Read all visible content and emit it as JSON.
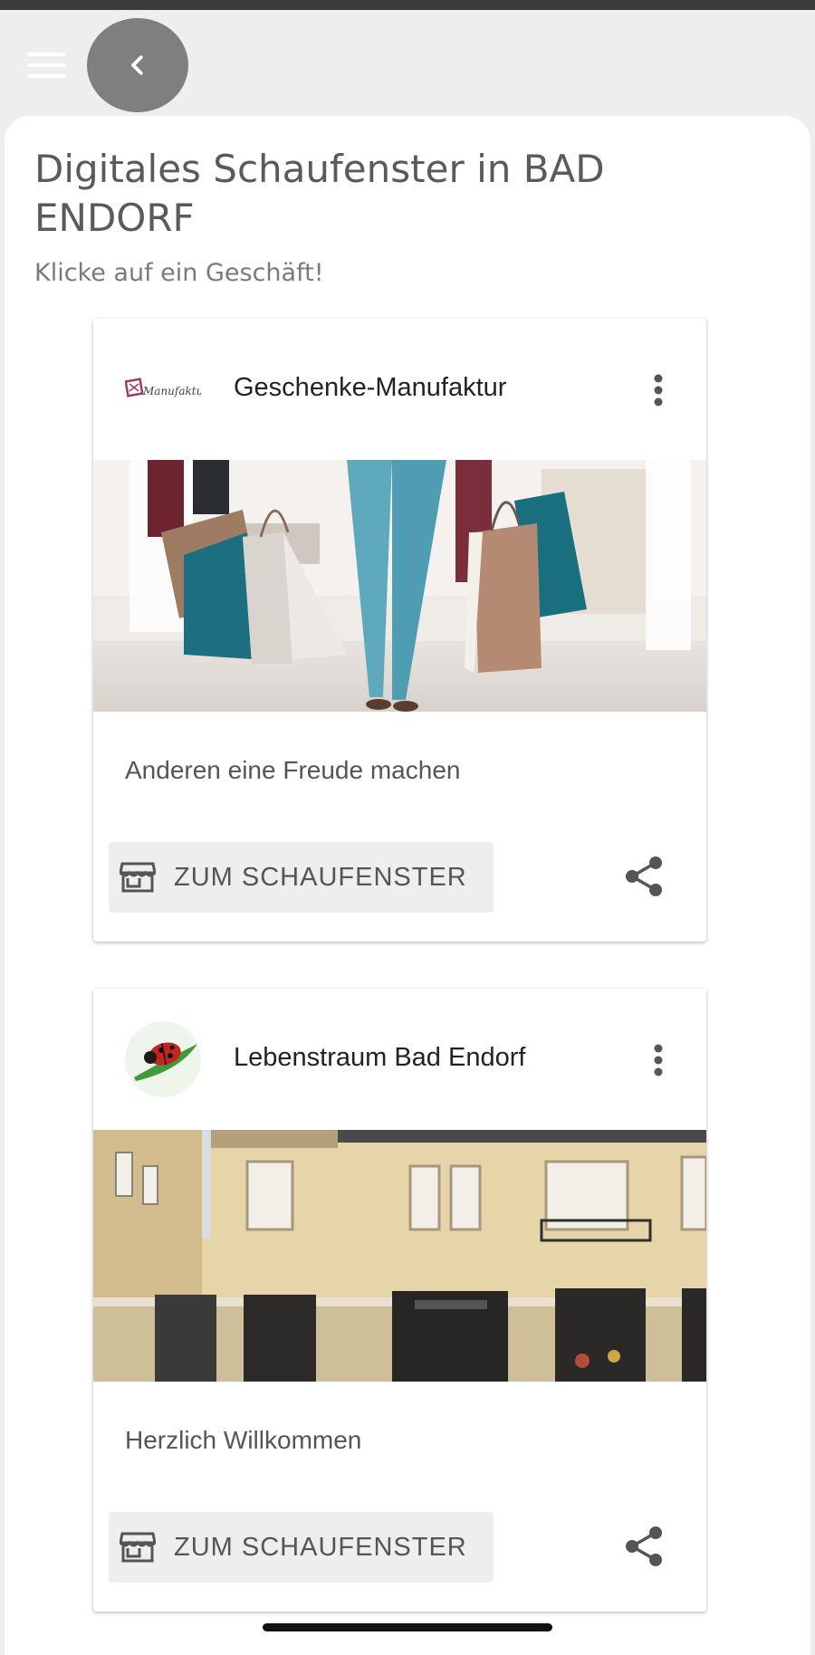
{
  "header": {
    "menu_icon": "hamburger-menu-icon",
    "back_icon": "chevron-left-icon"
  },
  "page": {
    "title": "Digitales Schaufenster in BAD ENDORF",
    "subtitle": "Klicke auf ein Geschäft!"
  },
  "shops": [
    {
      "name": "Geschenke-Manufaktur",
      "logo_text": "Manufaktur",
      "description": "Anderen eine Freude machen",
      "button_label": "ZUM SCHAUFENSTER",
      "image_subject": "shopping-bags-photo"
    },
    {
      "name": "Lebenstraum Bad Endorf",
      "description": "Herzlich Willkommen",
      "button_label": "ZUM SCHAUFENSTER",
      "image_subject": "storefront-building-photo"
    }
  ],
  "colors": {
    "background": "#eeeeee",
    "card": "#ffffff",
    "back_button": "#7f7f7f",
    "title_text": "#5a5a5a",
    "button_bg": "#eeeeee"
  }
}
